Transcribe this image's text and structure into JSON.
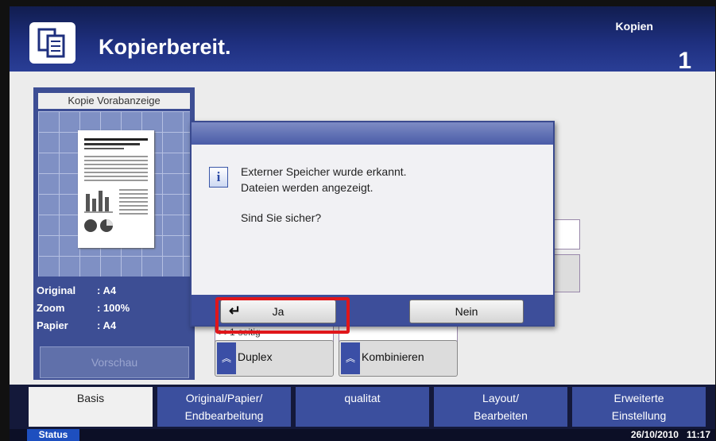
{
  "header": {
    "title": "Kopierbereit.",
    "copies_label": "Kopien",
    "copies_count": "1"
  },
  "preview": {
    "title": "Kopie Vorabanzeige",
    "rows": [
      {
        "label": "Original",
        "value": ": A4"
      },
      {
        "label": "Zoom",
        "value": ": 100%"
      },
      {
        "label": "Papier",
        "value": ": A4"
      }
    ],
    "button": "Vorschau"
  },
  "background": {
    "duplex_sub": ">>1-seitig",
    "duplex_label": "Duplex",
    "combine_label": "Kombinieren"
  },
  "dialog": {
    "line1": "Externer Speicher wurde erkannt.",
    "line2": "Dateien werden angezeigt.",
    "question": "Sind Sie sicher?",
    "yes": "Ja",
    "no": "Nein"
  },
  "tabs": [
    {
      "l1": "Basis",
      "l2": ""
    },
    {
      "l1": "Original/Papier/",
      "l2": "Endbearbeitung"
    },
    {
      "l1": "qualitat",
      "l2": ""
    },
    {
      "l1": "Layout/",
      "l2": "Bearbeiten"
    },
    {
      "l1": "Erweiterte",
      "l2": "Einstellung"
    }
  ],
  "status": {
    "button": "Status",
    "date": "26/10/2010",
    "time": "11:17"
  },
  "colors": {
    "highlight": "#e0161a",
    "header": "#1e2f7e"
  }
}
